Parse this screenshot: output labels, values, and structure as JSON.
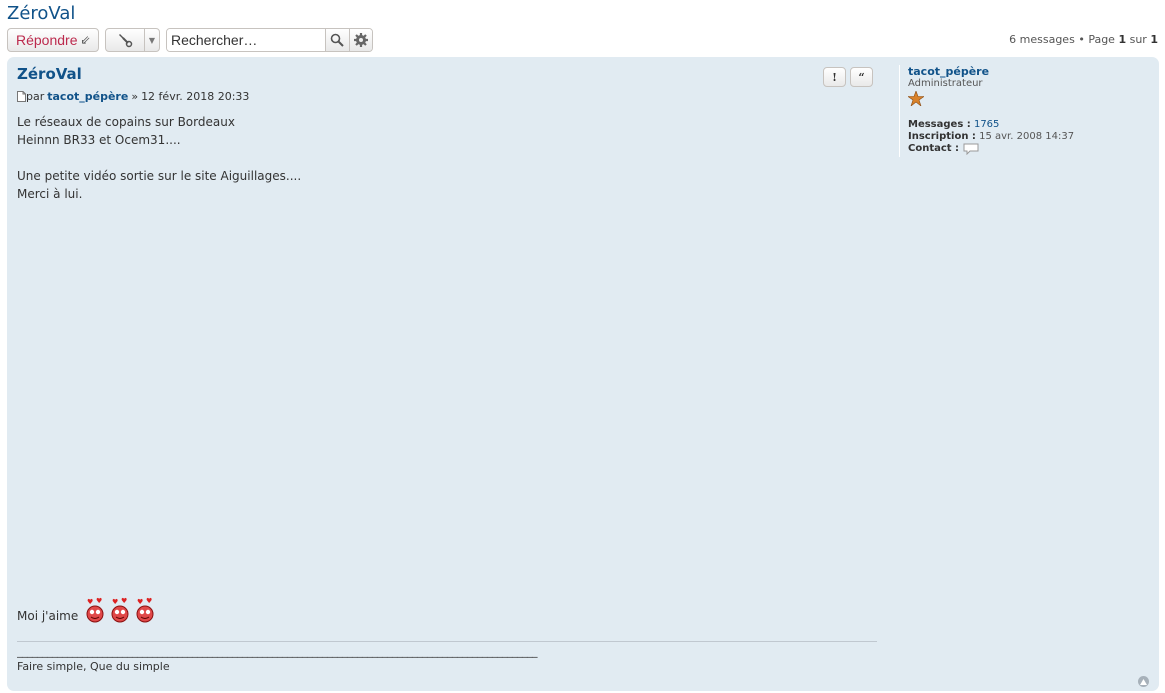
{
  "topic": {
    "title": "ZéroVal"
  },
  "toolbar": {
    "reply_label": "Répondre",
    "search_placeholder": "Rechercher…"
  },
  "pagination": {
    "count_text": "6 messages",
    "bullet": "•",
    "page_word": "Page",
    "current": "1",
    "of_word": "sur",
    "total": "1"
  },
  "post": {
    "title": "ZéroVal",
    "by_word": "par",
    "author": "tacot_pépère",
    "separator": "»",
    "date": "12 févr. 2018 20:33",
    "content_lines": [
      "Le réseaux de copains sur Bordeaux",
      "Heinnn BR33 et Ocem31....",
      "",
      "Une petite vidéo sortie sur le site Aiguillages....",
      "Merci à lui."
    ],
    "likes_text": "Moi j'aime",
    "signature_rule": "________________________________________________________________________________________________________",
    "signature": "Faire simple, Que du simple",
    "report_label": "!",
    "quote_label": "“"
  },
  "profile": {
    "username": "tacot_pépère",
    "rank": "Administrateur",
    "messages_label": "Messages :",
    "messages_value": "1765",
    "joined_label": "Inscription :",
    "joined_value": "15 avr. 2008 14:37",
    "contact_label": "Contact :"
  },
  "colors": {
    "link": "#105289",
    "reply": "#bc2a4d",
    "post_bg": "#e1ebf2"
  }
}
